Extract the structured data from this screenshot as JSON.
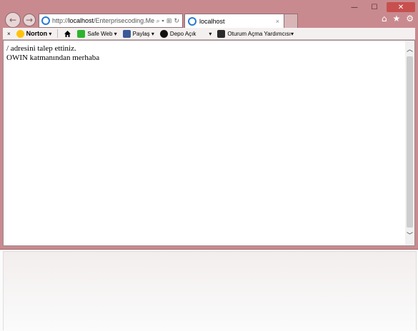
{
  "window": {
    "controls": {
      "minimize": "—",
      "maximize": "☐",
      "close": "✕"
    }
  },
  "nav": {
    "back_icon": "back-arrow-icon",
    "forward_icon": "forward-arrow-icon",
    "address": {
      "prefix": "http://",
      "host": "localhost",
      "path": "/Enterprisecoding.Me"
    },
    "address_tools": [
      "⌕ ▾",
      "⊞",
      "↻"
    ]
  },
  "tab": {
    "title": "localhost",
    "close": "×"
  },
  "right_icons": [
    "⌂",
    "★",
    "⚙"
  ],
  "toolbar": {
    "close": "×",
    "norton": "Norton",
    "safe_web": "Safe Web",
    "share": "Paylaş",
    "vault": "Depo Açık",
    "login_assistant": "Oturum Açma Yardımcısı"
  },
  "content": {
    "line1": "/ adresini talep ettiniz.",
    "line2": "OWIN katmanından merhaba"
  },
  "colors": {
    "frame": "#c98a8f",
    "close_button": "#c7504f",
    "link_blue": "#2a7bd1"
  }
}
